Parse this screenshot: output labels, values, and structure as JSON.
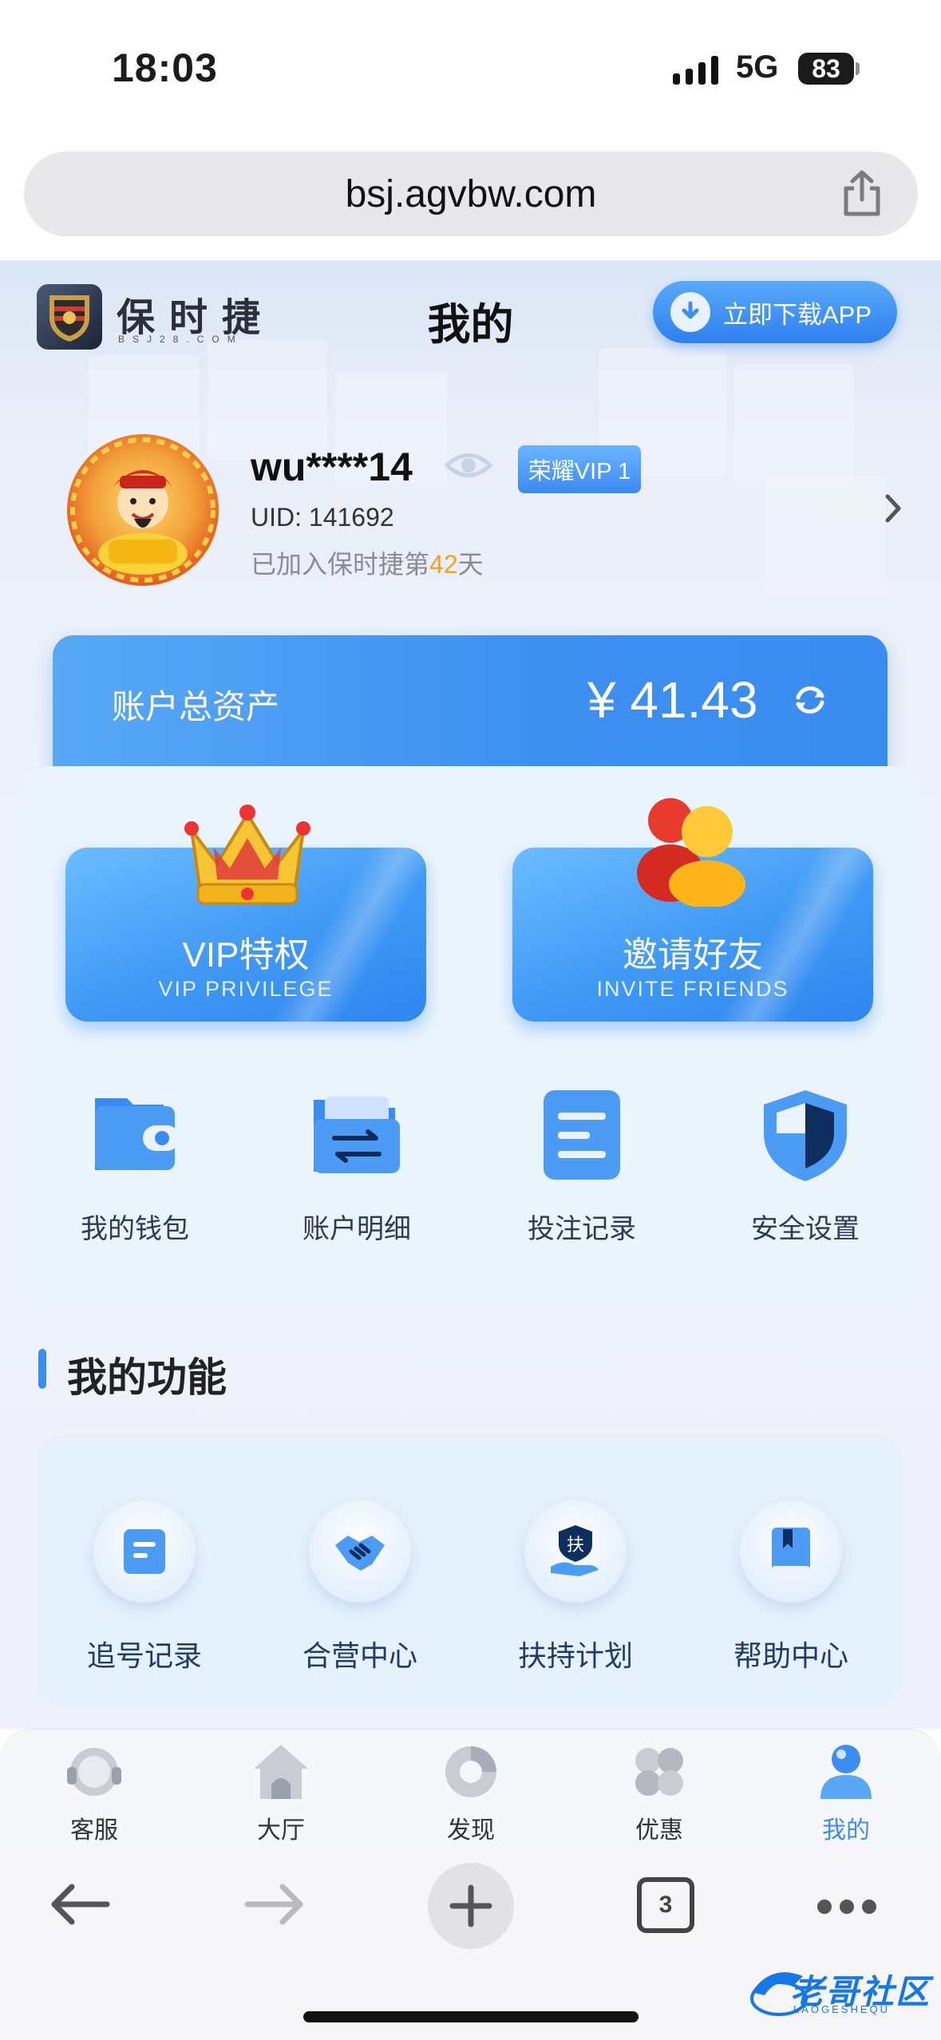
{
  "status_bar": {
    "time": "18:03",
    "network": "5G",
    "battery": "83"
  },
  "browser": {
    "url": "bsj.agvbw.com",
    "tab_count": "3"
  },
  "header": {
    "logo_text": "保时捷",
    "logo_sub": "BSJ28.COM",
    "title": "我的",
    "download_label": "立即下载APP"
  },
  "profile": {
    "username": "wu****14",
    "vip_badge": "荣耀VIP 1",
    "uid": "UID: 141692",
    "joined_prefix": "已加入保时捷第",
    "joined_days": "42",
    "joined_suffix": "天"
  },
  "assets": {
    "label": "账户总资产",
    "value": "¥ 41.43"
  },
  "feature_cards": [
    {
      "title": "VIP特权",
      "subtitle": "VIP PRIVILEGE"
    },
    {
      "title": "邀请好友",
      "subtitle": "INVITE FRIENDS"
    }
  ],
  "quick_actions": [
    {
      "label": "我的钱包",
      "icon": "wallet-icon"
    },
    {
      "label": "账户明细",
      "icon": "folder-transfer-icon"
    },
    {
      "label": "投注记录",
      "icon": "document-icon"
    },
    {
      "label": "安全设置",
      "icon": "shield-icon"
    }
  ],
  "functions_section": {
    "title": "我的功能",
    "items": [
      {
        "label": "追号记录",
        "icon": "note-icon"
      },
      {
        "label": "合营中心",
        "icon": "handshake-icon"
      },
      {
        "label": "扶持计划",
        "icon": "support-hand-icon"
      },
      {
        "label": "帮助中心",
        "icon": "book-icon"
      }
    ]
  },
  "tab_bar": [
    {
      "label": "客服",
      "icon": "headset-icon"
    },
    {
      "label": "大厅",
      "icon": "home-icon"
    },
    {
      "label": "发现",
      "icon": "discover-icon"
    },
    {
      "label": "优惠",
      "icon": "clover-icon"
    },
    {
      "label": "我的",
      "icon": "user-icon",
      "active": true
    }
  ],
  "watermark": {
    "text": "老哥社区",
    "sub": "LAOGESHEQU"
  },
  "colors": {
    "accent": "#3b8df2",
    "highlight": "#f3a322",
    "page_bg": "#eef2fa"
  }
}
